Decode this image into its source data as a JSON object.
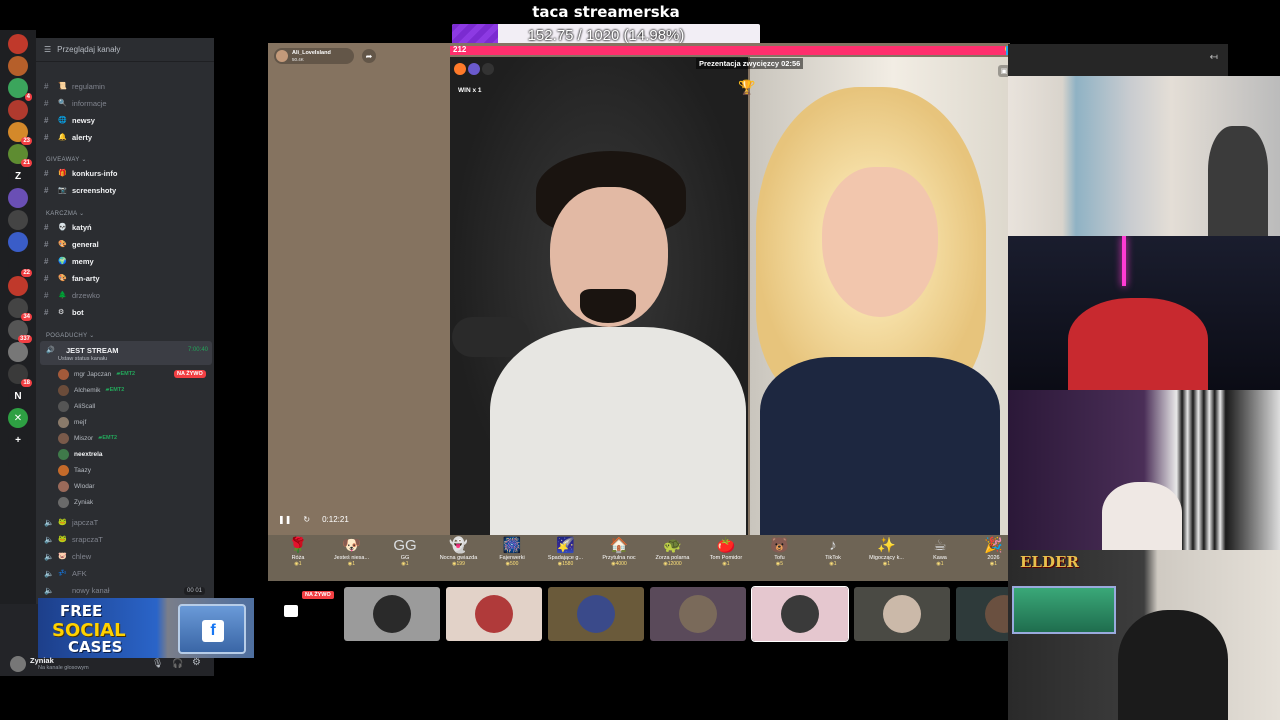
{
  "overlay": {
    "goal_title": "taca streamerska",
    "goal_text": "152.75 / 1020 (14.98%)",
    "goal_fraction": 0.1498
  },
  "discord": {
    "browse_channels": "Przeglądaj kanały",
    "channels_top": [
      {
        "label": "regulamin",
        "unread": false,
        "emoji": "📜"
      },
      {
        "label": "informacje",
        "unread": false,
        "emoji": "🔍"
      },
      {
        "label": "newsy",
        "unread": true,
        "emoji": "🌐"
      },
      {
        "label": "alerty",
        "unread": true,
        "emoji": "🔔"
      }
    ],
    "category_giveaway": "GIVEAWAY",
    "channels_giveaway": [
      {
        "label": "konkurs-info",
        "unread": true,
        "emoji": "🎁"
      },
      {
        "label": "screenshoty",
        "unread": true,
        "emoji": "📷"
      }
    ],
    "category_karczma": "KARCZMA",
    "channels_karczma": [
      {
        "label": "katyń",
        "unread": true,
        "emoji": "💀"
      },
      {
        "label": "general",
        "unread": true,
        "emoji": "🎨"
      },
      {
        "label": "memy",
        "unread": true,
        "emoji": "🌍"
      },
      {
        "label": "fan-arty",
        "unread": true,
        "emoji": "🎨"
      },
      {
        "label": "drzewko",
        "unread": false,
        "emoji": "🌲"
      },
      {
        "label": "bot",
        "unread": true,
        "emoji": "⚙"
      }
    ],
    "category_pogaduchy": "POGADUCHY",
    "voice_channel": {
      "label": "JEST STREAM",
      "status": "Ustaw status kanału",
      "timer": "7:00:40"
    },
    "voice_users": [
      {
        "name": "mgr Japczan",
        "tag": "EMT2",
        "bold": false,
        "color": "#a35a3a"
      },
      {
        "name": "Alchemik",
        "tag": "EMT2",
        "bold": false,
        "color": "#6b4c3a"
      },
      {
        "name": "AliScall",
        "tag": "",
        "bold": false,
        "color": "#555555"
      },
      {
        "name": "mejf",
        "tag": "",
        "bold": false,
        "color": "#8a7a6a"
      },
      {
        "name": "Miszor",
        "tag": "EMT2",
        "bold": false,
        "color": "#7a5a4a"
      },
      {
        "name": "neextrela",
        "tag": "",
        "bold": true,
        "color": "#3f7a4a"
      },
      {
        "name": "Taazy",
        "tag": "",
        "bold": false,
        "color": "#c46a2a"
      },
      {
        "name": "Wlodar",
        "tag": "",
        "bold": false,
        "color": "#9a6a5a"
      },
      {
        "name": "Zyniak",
        "tag": "",
        "bold": false,
        "color": "#6a6a6a"
      }
    ],
    "live_badge": "NA ŻYWO",
    "channels_bottom": [
      {
        "label": "japczaT",
        "emoji": "🐸"
      },
      {
        "label": "srapczaT",
        "emoji": "🐸"
      },
      {
        "label": "chlew",
        "emoji": "🐷"
      },
      {
        "label": "AFK",
        "emoji": "💤"
      },
      {
        "label": "nowy kanał",
        "emoji": ""
      }
    ],
    "bottom_counter": "00  01",
    "ad": {
      "line1": "FREE",
      "line2": "SOCIAL",
      "line3": "CASES"
    },
    "user_name": "Zyniak",
    "user_status": "Na kanale głosowym",
    "server_badges": [
      "4",
      "23",
      "21",
      "22",
      "34",
      "337",
      "18"
    ]
  },
  "tiktok": {
    "host_name": "Ali_LoveIsland",
    "host_viewers": "50.4K",
    "score_left": "212",
    "score_right": "0",
    "winner_text": "Prezentacja zwycięzcy 02:56",
    "win_badge": "WIN x 1",
    "elapsed": "0:12:21",
    "gifts": [
      {
        "name": "Róża",
        "cost": "1",
        "icon": "🌹"
      },
      {
        "name": "Jesteś niesa...",
        "cost": "1",
        "icon": "🐶"
      },
      {
        "name": "GG",
        "cost": "1",
        "icon": "GG"
      },
      {
        "name": "Nocna gwiazda",
        "cost": "199",
        "icon": "👻"
      },
      {
        "name": "Fajerwerki",
        "cost": "500",
        "icon": "🎆"
      },
      {
        "name": "Spadające g...",
        "cost": "1580",
        "icon": "🌠"
      },
      {
        "name": "Przytulna noc",
        "cost": "4000",
        "icon": "🏠"
      },
      {
        "name": "Zorza polarna",
        "cost": "12000",
        "icon": "🐢"
      },
      {
        "name": "Tom Pomidor",
        "cost": "1",
        "icon": "🍅"
      },
      {
        "name": "Tofu",
        "cost": "5",
        "icon": "🐻"
      },
      {
        "name": "TikTok",
        "cost": "1",
        "icon": "♪"
      },
      {
        "name": "Migoczący k...",
        "cost": "1",
        "icon": "✨"
      },
      {
        "name": "Kawa",
        "cost": "1",
        "icon": "☕"
      },
      {
        "name": "2026",
        "cost": "1",
        "icon": "🎉"
      }
    ],
    "viewer_live_badge": "NA ŻYWO",
    "viewer_tiles": [
      {
        "bg": "#9b9b9b",
        "av": "#2a2a2a"
      },
      {
        "bg": "#e2d2c8",
        "av": "#b03a3a"
      },
      {
        "bg": "#6a5a3a",
        "av": "#3a4a8a"
      },
      {
        "bg": "#5a4a5a",
        "av": "#7a6a5a"
      },
      {
        "bg": "#e5c7cf",
        "av": "#3a3a3a"
      },
      {
        "bg": "#4a4a44",
        "av": "#cbb9a9"
      },
      {
        "bg": "#2e3a3a",
        "av": "#6a5040"
      }
    ]
  },
  "cams": {
    "elder_logo": "ELDER"
  }
}
